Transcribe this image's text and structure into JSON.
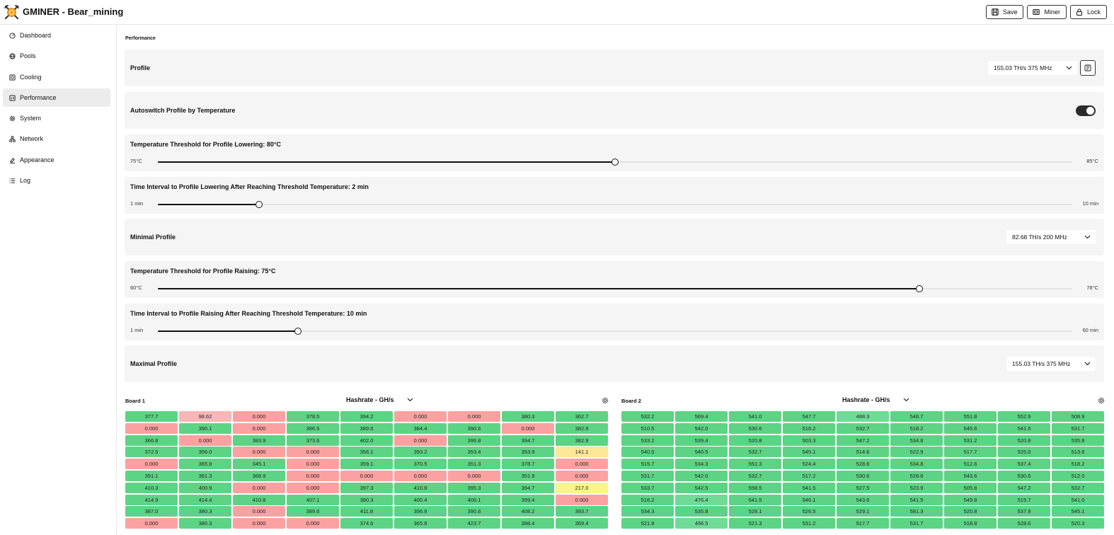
{
  "app": {
    "title": "GMINER - Bear_mining"
  },
  "toolbar": {
    "save_label": "Save",
    "miner_label": "Miner",
    "lock_label": "Lock"
  },
  "sidebar": {
    "items": [
      {
        "label": "Dashboard",
        "icon": "dashboard-icon"
      },
      {
        "label": "Pools",
        "icon": "globe-icon"
      },
      {
        "label": "Cooling",
        "icon": "fan-icon"
      },
      {
        "label": "Performance",
        "icon": "performance-icon",
        "active": true
      },
      {
        "label": "System",
        "icon": "gear-icon"
      },
      {
        "label": "Network",
        "icon": "network-icon"
      },
      {
        "label": "Appearance",
        "icon": "paint-icon"
      },
      {
        "label": "Log",
        "icon": "list-icon"
      }
    ]
  },
  "performance": {
    "section_title": "Performance",
    "profile": {
      "label": "Profile",
      "value": "155.03 TH/s 375 MHz"
    },
    "autoswitch": {
      "label": "Autoswitch Profile by Temperature",
      "enabled": true
    },
    "temp_lowering": {
      "label": "Temperature Threshold for Profile Lowering: 80°C",
      "min": "75°C",
      "max": "85°C",
      "fraction": 0.5
    },
    "time_lowering": {
      "label": "Time Interval to Profile Lowering After Reaching Threshold Temperature: 2 min",
      "min": "1 min",
      "max": "10 min",
      "fraction": 0.111
    },
    "minimal_profile": {
      "label": "Minimal Profile",
      "value": "82.68 TH/s 200 MHz"
    },
    "temp_raising": {
      "label": "Temperature Threshold for Profile Raising: 75°C",
      "min": "60°C",
      "max": "78°C",
      "fraction": 0.833
    },
    "time_raising": {
      "label": "Time Interval to Profile Raising After Reaching Threshold Temperature: 10 min",
      "min": "1 min",
      "max": "60 min",
      "fraction": 0.153
    },
    "maximal_profile": {
      "label": "Maximal Profile",
      "value": "155.03 TH/s 375 MHz"
    }
  },
  "colors": {
    "good": "#5dd385",
    "good_light": "#6fdb97",
    "bad": "#fca1a1",
    "bad_light": "#f8b6b6",
    "warn": "#fce896",
    "warn_bright": "#f6f68c"
  },
  "boards": [
    {
      "name": "Board 1",
      "metric": "Hashrate - GH/s",
      "cells": [
        [
          "377.7",
          "98.62",
          "0.000",
          "378.5",
          "394.2",
          "0.000",
          "0.000",
          "380.3",
          "362.7"
        ],
        [
          "0.000",
          "390.1",
          "0.000",
          "386.5",
          "389.6",
          "384.4",
          "390.6",
          "0.000",
          "382.9"
        ],
        [
          "366.8",
          "0.000",
          "383.9",
          "373.6",
          "402.0",
          "0.000",
          "396.8",
          "394.7",
          "382.9"
        ],
        [
          "372.5",
          "356.0",
          "0.000",
          "0.000",
          "356.1",
          "393.2",
          "353.4",
          "353.9",
          "141.1"
        ],
        [
          "0.000",
          "365.8",
          "345.1",
          "0.000",
          "359.1",
          "370.5",
          "351.3",
          "378.7",
          "0.000"
        ],
        [
          "391.1",
          "381.3",
          "368.9",
          "0.000",
          "0.000",
          "0.000",
          "0.000",
          "351.9",
          "0.000"
        ],
        [
          "410.3",
          "400.9",
          "0.000",
          "0.000",
          "397.3",
          "410.8",
          "395.3",
          "394.7",
          "217.0"
        ],
        [
          "414.9",
          "414.4",
          "410.8",
          "407.1",
          "380.3",
          "400.4",
          "406.1",
          "399.4",
          "0.000"
        ],
        [
          "387.0",
          "380.3",
          "0.000",
          "389.6",
          "411.8",
          "396.8",
          "390.6",
          "408.2",
          "393.7"
        ],
        [
          "0.000",
          "380.3",
          "0.000",
          "0.000",
          "374.6",
          "365.8",
          "423.7",
          "398.4",
          "369.4"
        ]
      ]
    },
    {
      "name": "Board 2",
      "metric": "Hashrate - GH/s",
      "cells": [
        [
          "532.2",
          "569.4",
          "541.0",
          "547.7",
          "488.3",
          "548.7",
          "551.8",
          "552.9",
          "508.9"
        ],
        [
          "510.5",
          "542.0",
          "530.6",
          "516.2",
          "532.7",
          "518.2",
          "545.6",
          "541.5",
          "531.7"
        ],
        [
          "533.2",
          "539.4",
          "520.8",
          "503.3",
          "547.2",
          "534.8",
          "531.2",
          "520.8",
          "535.8"
        ],
        [
          "540.5",
          "540.5",
          "532.7",
          "545.1",
          "514.6",
          "522.9",
          "517.7",
          "525.0",
          "513.6"
        ],
        [
          "515.7",
          "534.3",
          "551.3",
          "524.4",
          "528.6",
          "534.8",
          "512.6",
          "537.4",
          "518.2"
        ],
        [
          "531.7",
          "542.0",
          "532.7",
          "517.2",
          "530.6",
          "528.6",
          "543.6",
          "530.6",
          "512.0"
        ],
        [
          "533.7",
          "542.5",
          "558.5",
          "541.5",
          "527.5",
          "523.9",
          "505.8",
          "547.2",
          "532.7"
        ],
        [
          "518.2",
          "476.4",
          "541.5",
          "546.1",
          "543.6",
          "541.5",
          "549.8",
          "515.7",
          "541.0"
        ],
        [
          "534.3",
          "535.8",
          "528.1",
          "526.5",
          "529.1",
          "581.3",
          "520.8",
          "537.9",
          "545.1"
        ],
        [
          "521.9",
          "496.5",
          "521.3",
          "531.2",
          "517.7",
          "531.7",
          "518.8",
          "528.6",
          "520.3"
        ]
      ]
    }
  ]
}
